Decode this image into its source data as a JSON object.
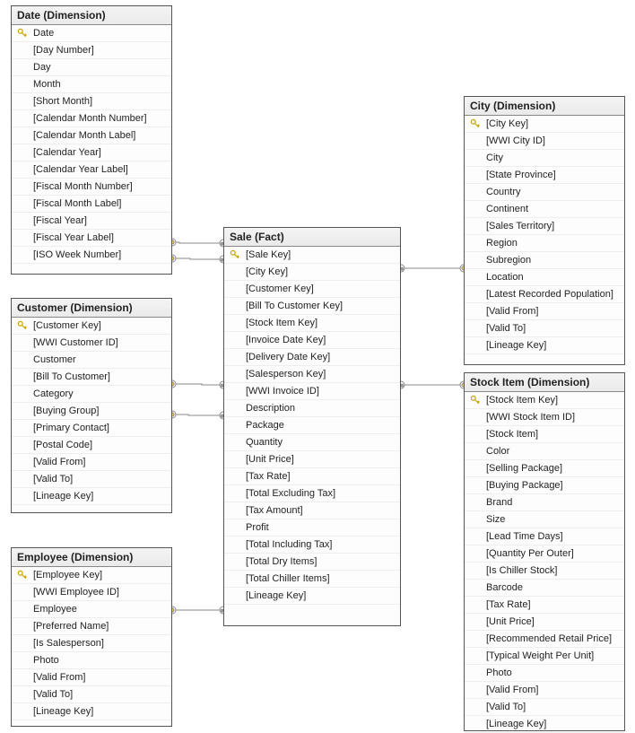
{
  "tables": {
    "date": {
      "title": "Date (Dimension)",
      "columns": [
        {
          "label": "Date",
          "pk": true
        },
        {
          "label": "[Day Number]"
        },
        {
          "label": "Day"
        },
        {
          "label": "Month"
        },
        {
          "label": "[Short Month]"
        },
        {
          "label": "[Calendar Month Number]"
        },
        {
          "label": "[Calendar Month Label]"
        },
        {
          "label": "[Calendar Year]"
        },
        {
          "label": "[Calendar Year Label]"
        },
        {
          "label": "[Fiscal Month Number]"
        },
        {
          "label": "[Fiscal Month Label]"
        },
        {
          "label": "[Fiscal Year]"
        },
        {
          "label": "[Fiscal Year Label]"
        },
        {
          "label": "[ISO Week Number]"
        }
      ]
    },
    "customer": {
      "title": "Customer (Dimension)",
      "columns": [
        {
          "label": "[Customer Key]",
          "pk": true
        },
        {
          "label": "[WWI Customer ID]"
        },
        {
          "label": "Customer"
        },
        {
          "label": "[Bill To Customer]"
        },
        {
          "label": "Category"
        },
        {
          "label": "[Buying Group]"
        },
        {
          "label": "[Primary Contact]"
        },
        {
          "label": "[Postal Code]"
        },
        {
          "label": "[Valid From]"
        },
        {
          "label": "[Valid To]"
        },
        {
          "label": "[Lineage Key]"
        }
      ]
    },
    "employee": {
      "title": "Employee (Dimension)",
      "columns": [
        {
          "label": "[Employee Key]",
          "pk": true
        },
        {
          "label": "[WWI Employee ID]"
        },
        {
          "label": "Employee"
        },
        {
          "label": "[Preferred Name]"
        },
        {
          "label": "[Is Salesperson]"
        },
        {
          "label": "Photo"
        },
        {
          "label": "[Valid From]"
        },
        {
          "label": "[Valid To]"
        },
        {
          "label": "[Lineage Key]"
        }
      ]
    },
    "sale": {
      "title": "Sale (Fact)",
      "columns": [
        {
          "label": "[Sale Key]",
          "pk": true
        },
        {
          "label": "[City Key]"
        },
        {
          "label": "[Customer Key]"
        },
        {
          "label": "[Bill To Customer Key]"
        },
        {
          "label": "[Stock Item Key]"
        },
        {
          "label": "[Invoice Date Key]"
        },
        {
          "label": "[Delivery Date Key]"
        },
        {
          "label": "[Salesperson Key]"
        },
        {
          "label": "[WWI Invoice ID]"
        },
        {
          "label": "Description"
        },
        {
          "label": "Package"
        },
        {
          "label": "Quantity"
        },
        {
          "label": "[Unit Price]"
        },
        {
          "label": "[Tax Rate]"
        },
        {
          "label": "[Total Excluding Tax]"
        },
        {
          "label": "[Tax Amount]"
        },
        {
          "label": "Profit"
        },
        {
          "label": "[Total Including Tax]"
        },
        {
          "label": "[Total Dry Items]"
        },
        {
          "label": "[Total Chiller Items]"
        },
        {
          "label": "[Lineage Key]"
        }
      ]
    },
    "city": {
      "title": "City (Dimension)",
      "columns": [
        {
          "label": "[City Key]",
          "pk": true
        },
        {
          "label": "[WWI City ID]"
        },
        {
          "label": "City"
        },
        {
          "label": "[State Province]"
        },
        {
          "label": "Country"
        },
        {
          "label": "Continent"
        },
        {
          "label": "[Sales Territory]"
        },
        {
          "label": "Region"
        },
        {
          "label": "Subregion"
        },
        {
          "label": "Location"
        },
        {
          "label": "[Latest Recorded Population]"
        },
        {
          "label": "[Valid From]"
        },
        {
          "label": "[Valid To]"
        },
        {
          "label": "[Lineage Key]"
        }
      ]
    },
    "stockitem": {
      "title": "Stock Item (Dimension)",
      "columns": [
        {
          "label": "[Stock Item Key]",
          "pk": true
        },
        {
          "label": "[WWI Stock Item ID]"
        },
        {
          "label": "[Stock Item]"
        },
        {
          "label": "Color"
        },
        {
          "label": "[Selling Package]"
        },
        {
          "label": "[Buying Package]"
        },
        {
          "label": "Brand"
        },
        {
          "label": "Size"
        },
        {
          "label": "[Lead Time Days]"
        },
        {
          "label": "[Quantity Per Outer]"
        },
        {
          "label": "[Is Chiller Stock]"
        },
        {
          "label": "Barcode"
        },
        {
          "label": "[Tax Rate]"
        },
        {
          "label": "[Unit Price]"
        },
        {
          "label": "[Recommended Retail Price]"
        },
        {
          "label": "[Typical Weight Per Unit]"
        },
        {
          "label": "Photo"
        },
        {
          "label": "[Valid From]"
        },
        {
          "label": "[Valid To]"
        },
        {
          "label": "[Lineage Key]"
        }
      ]
    }
  },
  "relationships": [
    {
      "from": "sale",
      "to": "date",
      "note": "Invoice Date Key -> Date"
    },
    {
      "from": "sale",
      "to": "date",
      "note": "Delivery Date Key -> Date"
    },
    {
      "from": "sale",
      "to": "customer",
      "note": "Customer Key"
    },
    {
      "from": "sale",
      "to": "customer",
      "note": "Bill To Customer Key"
    },
    {
      "from": "sale",
      "to": "employee",
      "note": "Salesperson Key -> Employee Key"
    },
    {
      "from": "sale",
      "to": "city",
      "note": "City Key"
    },
    {
      "from": "sale",
      "to": "stockitem",
      "note": "Stock Item Key"
    }
  ]
}
